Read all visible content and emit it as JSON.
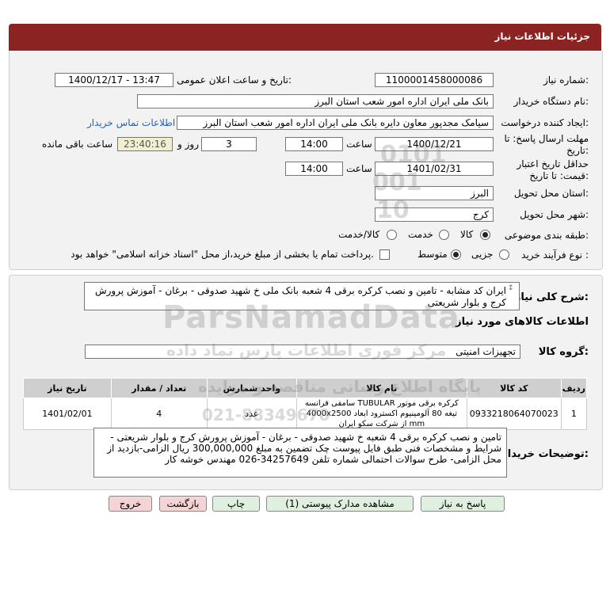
{
  "header": {
    "title": "جزئیات اطلاعات نیاز"
  },
  "form": {
    "need_number_label": "شماره نیاز:",
    "need_number": "1100001458000086",
    "announce_label": "تاریخ و ساعت اعلان عمومی:",
    "announce_value": "1400/12/17 - 13:47",
    "buyer_label": "نام دستگاه خریدار:",
    "buyer_value": "بانک ملی ایران اداره امور شعب استان البرز",
    "creator_label": "ایجاد کننده درخواست:",
    "creator_value": "سیامک مجدپور معاون دایره  بانک ملی ایران اداره امور شعب استان البرز",
    "contact_link": "اطلاعات تماس خریدار",
    "deadline_label_1": "مهلت ارسال پاسخ: تا",
    "deadline_label_2": "تاریخ:",
    "deadline_date": "1400/12/21",
    "time_label": "ساعت",
    "deadline_time": "14:00",
    "days_value": "3",
    "days_label": "روز و",
    "remaining_value": "23:40:16",
    "remaining_label": "ساعت باقی مانده",
    "validity_label_1": "حداقل تاریخ اعتبار",
    "validity_label_2": "قیمت: تا تاریخ:",
    "validity_date": "1401/02/31",
    "validity_time": "14:00",
    "province_label": "استان محل تحویل:",
    "province_value": "البرز",
    "city_label": "شهر محل تحویل:",
    "city_value": "کرج",
    "category_label": "طبقه بندی موضوعی:",
    "category_options": [
      "کالا",
      "خدمت",
      "کالا/خدمت"
    ],
    "category_selected": "کالا",
    "process_label": "نوع فرآیند خرید :",
    "process_options": [
      "جزیی",
      "متوسط"
    ],
    "process_selected": "متوسط",
    "payment_note": "پرداخت تمام یا بخشی از مبلغ خرید،از محل \"اسناد خزانه اسلامی\" خواهد بود."
  },
  "summary": {
    "label": "شرح کلی نیاز:",
    "text": "ایران کد مشابه - تامین و  نصب کرکره برقی 4 شعبه بانک ملی خ شهید صدوقی - برغان - آموزش پرورش کرج و بلوار شریعتی"
  },
  "goods": {
    "section_title": "اطلاعات کالاهای مورد نیاز",
    "group_label": "گروه کالا:",
    "group_value": "تجهیزات امنیتی",
    "columns": [
      "ردیف",
      "کد کالا",
      "نام کالا",
      "واحد شمارش",
      "تعداد / مقدار",
      "تاریخ نیاز"
    ],
    "rows": [
      {
        "row": "1",
        "code": "0933218064070023",
        "name": "کرکره برقی موتور TUBULAR سامفی فرانسه تیغه 80 آلومینیوم اکسترود ابعاد 4000x2500 mm از شرکت سکو ایران",
        "unit": "عدد",
        "qty": "4",
        "date": "1401/02/01"
      }
    ]
  },
  "buyer_notes": {
    "label": "توضیحات خریدار:",
    "text": "تامین و نصب کرکره برقی 4 شعبه  خ شهید صدوقی - برغان - آموزش پرورش کرج و بلوار شریعتی - شرایط و مشخصات فنی طبق فایل پیوست چک تضمین به مبلغ 300,000,000 ریال الزامی-بازدید از محل الزامی- طرح سوالات احتمالی شماره تلفن 34257649-026 مهندس خوشه کار"
  },
  "buttons": {
    "reply": "پاسخ به نیاز",
    "attachments": "مشاهده مدارک پیوستی (1)",
    "print": "چاپ",
    "back": "بازگشت",
    "exit": "خروج"
  },
  "watermark": {
    "main": "ParsNamadData",
    "line1": "مرکز فوری اطلاعات پارس نماد داده",
    "line2": "پایگاه اطلاع رسانی مناقصه و مزایده",
    "phone": "021-88349670",
    "num1": "0101",
    "num2": "001",
    "num3": "10"
  },
  "colors": {
    "header": "#8b2323",
    "link": "#2a5fb0",
    "remaining_bg": "#f2efd0"
  }
}
